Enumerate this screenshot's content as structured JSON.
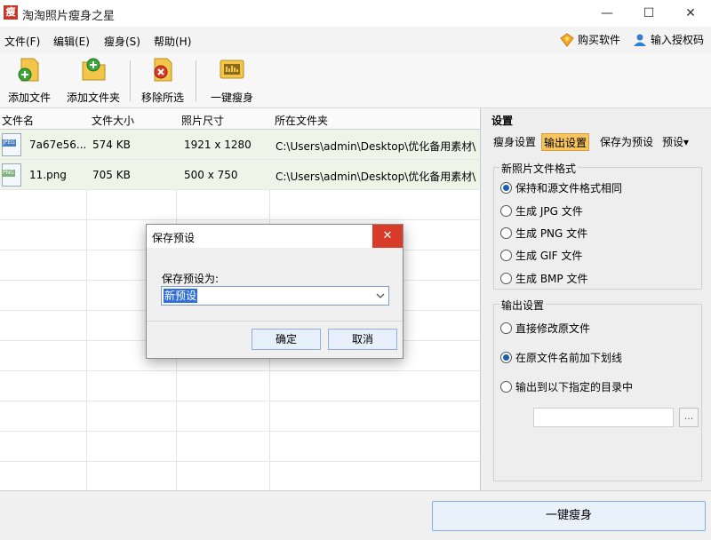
{
  "window": {
    "title": "淘淘照片瘦身之星",
    "app_icon_char": "瘦",
    "controls": [
      "—",
      "☐",
      "✕"
    ]
  },
  "menu": {
    "items": [
      "文件(F)",
      "编辑(E)",
      "瘦身(S)",
      "帮助(H)"
    ],
    "buy_label": "购买软件",
    "license_label": "输入授权码"
  },
  "toolbar": {
    "add_file": "添加文件",
    "add_folder": "添加文件夹",
    "remove_selected": "移除所选",
    "one_click_slim": "一键瘦身"
  },
  "table": {
    "headers": [
      "文件名",
      "文件大小",
      "照片尺寸",
      "所在文件夹"
    ],
    "rows": [
      {
        "icon": "JPEG",
        "name": "7a67e56...",
        "size": "574 KB",
        "dims": "1921 x 1280",
        "folder": "C:\\Users\\admin\\Desktop\\优化备用素材\\"
      },
      {
        "icon": "PNG",
        "name": "11.png",
        "size": "705 KB",
        "dims": "500 x 750",
        "folder": "C:\\Users\\admin\\Desktop\\优化备用素材\\"
      }
    ]
  },
  "settings": {
    "title": "设置",
    "tabs": [
      "瘦身设置",
      "输出设置",
      "保存为预设",
      "预设▾"
    ],
    "format_group": {
      "label": "新照片文件格式",
      "options": [
        "保持和源文件格式相同",
        "生成 JPG 文件",
        "生成 PNG 文件",
        "生成 GIF 文件",
        "生成 BMP 文件"
      ],
      "selected": 0
    },
    "output_group": {
      "label": "输出设置",
      "options": [
        "直接修改原文件",
        "在原文件名前加下划线",
        "输出到以下指定的目录中"
      ],
      "selected": 1,
      "browse_label": "..."
    }
  },
  "bottom": {
    "slim_button": "一键瘦身"
  },
  "dialog": {
    "title": "保存预设",
    "close": "✕",
    "label": "保存预设为:",
    "value": "新预设",
    "ok": "确定",
    "cancel": "取消"
  },
  "colors": {
    "active_tab": "#f6c460",
    "close_red": "#d93b2a",
    "row_selected": "#eef5e8",
    "selection_blue": "#2f6fd6"
  }
}
